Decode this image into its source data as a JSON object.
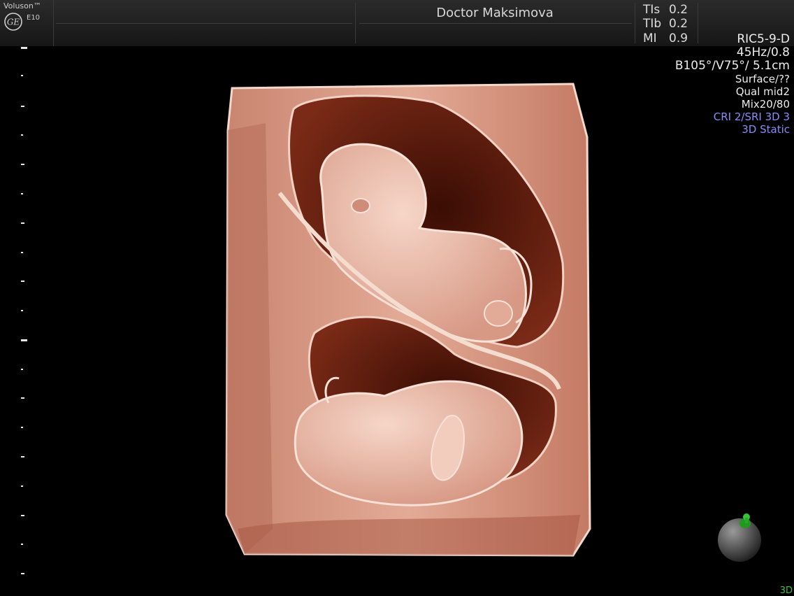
{
  "header": {
    "brand": "Voluson™",
    "model": "E10",
    "logo_icon": "ge-logo-icon",
    "operator": "Doctor Maksimova",
    "indices": [
      {
        "label": "TIs",
        "value": "0.2"
      },
      {
        "label": "TIb",
        "value": "0.2"
      },
      {
        "label": "MI",
        "value": "0.9"
      }
    ]
  },
  "scan_params": {
    "probe": "RIC5-9-D",
    "frequency": "45Hz/0.8",
    "angles": "B105°/V75°/ 5.1cm",
    "render_mode": "Surface/??",
    "quality": "Qual mid2",
    "mix": "Mix20/80",
    "cri_sri": "CRI 2/SRI 3D 3",
    "acquisition": "3D Static"
  },
  "render": {
    "description_icon": "fetus-3d-render",
    "colors": {
      "tissue": "#d99a86",
      "shadow": "#5a1a0c",
      "background": "#000000"
    }
  },
  "orientation": {
    "icon": "orientation-ball-icon",
    "marker_color": "#22b022"
  },
  "mode_indicator": "3D"
}
